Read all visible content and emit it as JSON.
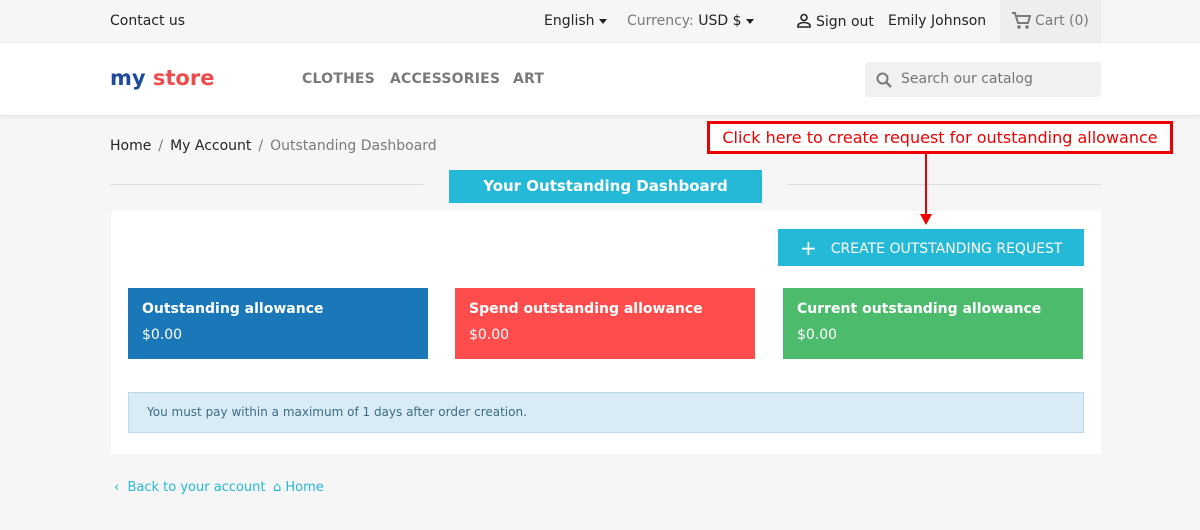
{
  "topbar": {
    "contact": "Contact us",
    "language": "English",
    "currency_label": "Currency:",
    "currency_value": "USD $",
    "sign_out": "Sign out",
    "user": "Emily Johnson",
    "cart": "Cart (0)"
  },
  "header": {
    "logo": "my store",
    "nav": [
      "CLOTHES",
      "ACCESSORIES",
      "ART"
    ],
    "search_placeholder": "Search our catalog"
  },
  "breadcrumb": [
    "Home",
    "My Account",
    "Outstanding Dashboard"
  ],
  "page_title": "Your Outstanding Dashboard",
  "annotation": "Click here to create request for outstanding allowance",
  "create_button": "CREATE OUTSTANDING REQUEST",
  "cards": [
    {
      "title": "Outstanding allowance",
      "value": "$0.00",
      "color": "#1a78b8"
    },
    {
      "title": "Spend outstanding allowance",
      "value": "$0.00",
      "color": "#ff4c4c"
    },
    {
      "title": "Current outstanding allowance",
      "value": "$0.00",
      "color": "#4cbb6c"
    }
  ],
  "notice": "You must pay within a maximum of 1 days after order creation.",
  "footer": {
    "back": "Back to your account",
    "home": "Home"
  }
}
